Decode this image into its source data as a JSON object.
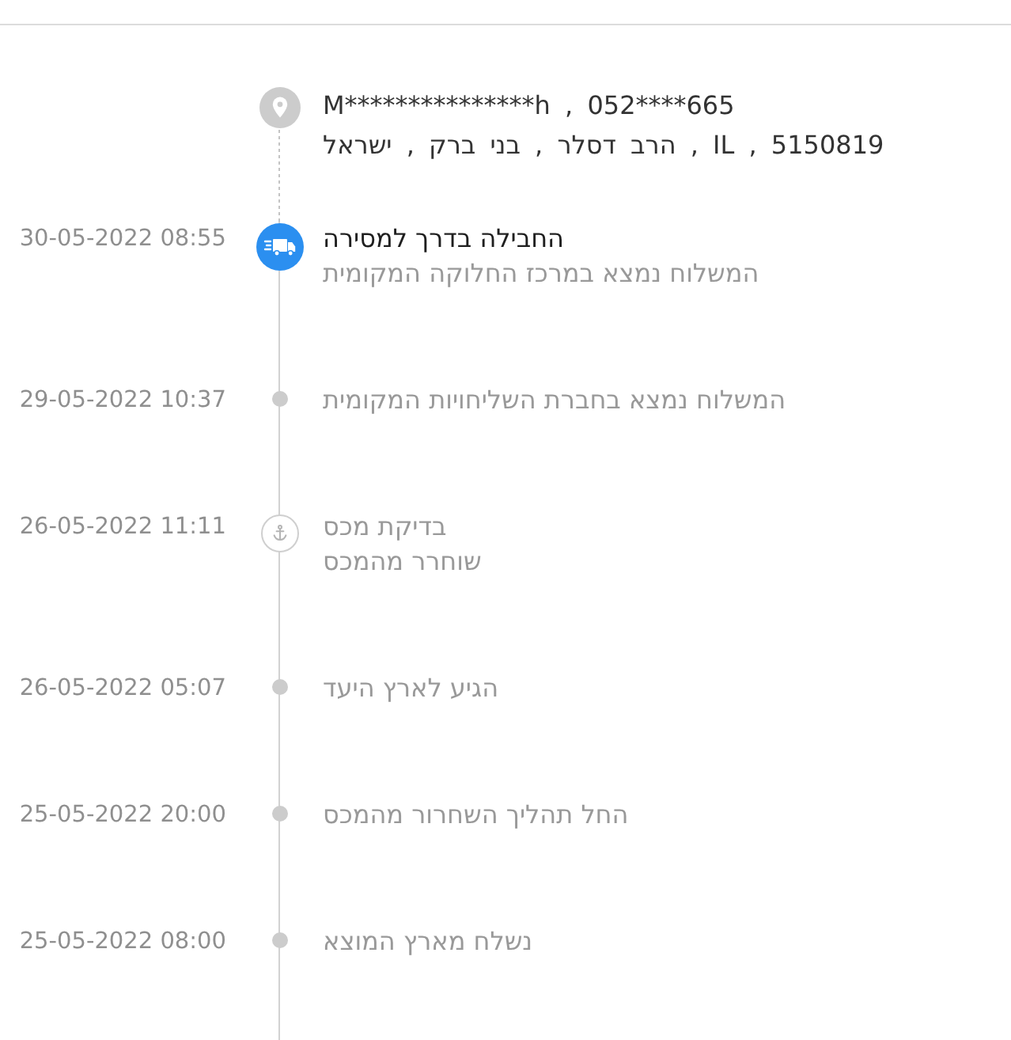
{
  "recipient": {
    "contact": "M***************h , 052****665",
    "address": "הרב דסלר , בני ברק , ישראל , IL , 5150819"
  },
  "events": [
    {
      "time": "30-05-2022 08:55",
      "kind": "transit",
      "current": true,
      "title": "החבילה בדרך למסירה",
      "detail": "המשלוח נמצא במרכז החלוקה המקומית"
    },
    {
      "time": "29-05-2022 10:37",
      "kind": "step",
      "current": false,
      "title": "המשלוח נמצא בחברת השליחויות המקומית"
    },
    {
      "time": "26-05-2022 11:11",
      "kind": "customs",
      "current": false,
      "title": "בדיקת מכס",
      "detail": "שוחרר מהמכס"
    },
    {
      "time": "26-05-2022 05:07",
      "kind": "step",
      "current": false,
      "title": "הגיע לארץ היעד"
    },
    {
      "time": "25-05-2022 20:00",
      "kind": "step",
      "current": false,
      "title": "החל תהליך השחרור מהמכס"
    },
    {
      "time": "25-05-2022 08:00",
      "kind": "step",
      "current": false,
      "title": "נשלח מארץ המוצא"
    }
  ]
}
